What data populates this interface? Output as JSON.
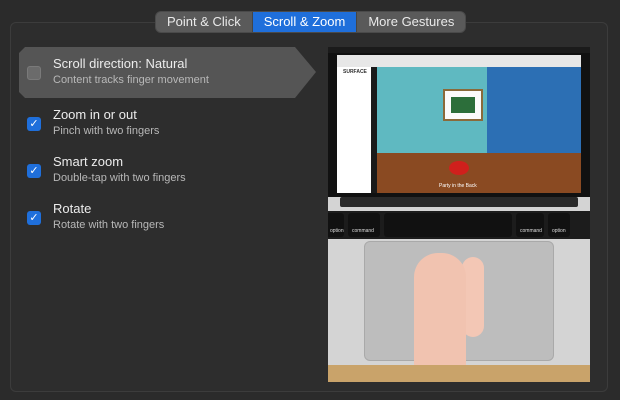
{
  "tabs": [
    {
      "label": "Point & Click",
      "active": false
    },
    {
      "label": "Scroll & Zoom",
      "active": true
    },
    {
      "label": "More Gestures",
      "active": false
    }
  ],
  "options": [
    {
      "title": "Scroll direction: Natural",
      "desc": "Content tracks finger movement",
      "checked": false,
      "selected": true
    },
    {
      "title": "Zoom in or out",
      "desc": "Pinch with two fingers",
      "checked": true,
      "selected": false
    },
    {
      "title": "Smart zoom",
      "desc": "Double-tap with two fingers",
      "checked": true,
      "selected": false
    },
    {
      "title": "Rotate",
      "desc": "Rotate with two fingers",
      "checked": true,
      "selected": false
    }
  ],
  "preview": {
    "site_name": "SURFACE",
    "caption": "Party in the Back",
    "keys": [
      {
        "symbol": "alt",
        "label": "option"
      },
      {
        "symbol": "⌘",
        "label": "command"
      },
      {
        "symbol": "⌘",
        "label": "command"
      },
      {
        "symbol": "alt",
        "label": "option"
      }
    ]
  },
  "colors": {
    "accent": "#1f6fdb",
    "background": "#2b2b2b",
    "selected_row": "#555555"
  }
}
